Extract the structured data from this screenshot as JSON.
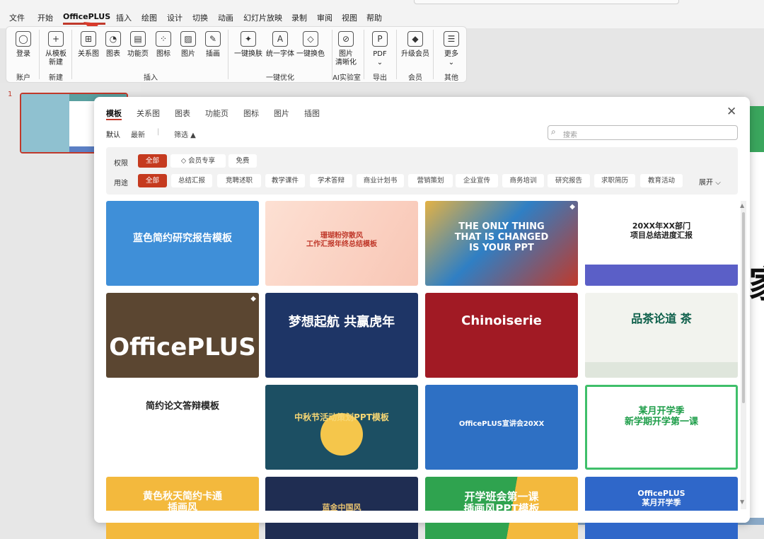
{
  "menu": {
    "items": [
      "文件",
      "开始",
      "OfficePLUS",
      "插入",
      "绘图",
      "设计",
      "切换",
      "动画",
      "幻灯片放映",
      "录制",
      "审阅",
      "视图",
      "帮助"
    ],
    "active_index": 2
  },
  "ribbon": {
    "buttons": [
      {
        "label": "登录",
        "icon": "user-icon"
      },
      {
        "label": "从模板\n新建",
        "icon": "new-from-template-icon"
      },
      {
        "label": "关系图",
        "icon": "relationship-diagram-icon"
      },
      {
        "label": "图表",
        "icon": "chart-icon"
      },
      {
        "label": "功能页",
        "icon": "function-page-icon"
      },
      {
        "label": "图标",
        "icon": "icons-icon"
      },
      {
        "label": "图片",
        "icon": "picture-icon"
      },
      {
        "label": "插画",
        "icon": "illustration-icon"
      },
      {
        "label": "一键换肤",
        "icon": "magic-wand-icon"
      },
      {
        "label": "统一字体",
        "icon": "font-icon"
      },
      {
        "label": "一键换色",
        "icon": "paint-bucket-icon"
      },
      {
        "label": "图片\n清晰化",
        "icon": "image-sharpen-icon"
      },
      {
        "label": "PDF\n⌄",
        "icon": "pdf-icon"
      },
      {
        "label": "升级会员",
        "icon": "diamond-icon"
      },
      {
        "label": "更多\n⌄",
        "icon": "more-icon"
      }
    ],
    "groups": [
      "账户",
      "新建",
      "插入",
      "一键优化",
      "AI实验室",
      "导出",
      "会员",
      "其他"
    ]
  },
  "slides": {
    "current_number": "1"
  },
  "panel": {
    "tabs": [
      "模板",
      "关系图",
      "图表",
      "功能页",
      "图标",
      "图片",
      "插图"
    ],
    "active_tab": 0,
    "sort": [
      "默认",
      "最新"
    ],
    "filter_toggle": "筛选 ▲",
    "search_placeholder": "搜索",
    "permission": {
      "label": "权限",
      "options": [
        "全部",
        "会员专享",
        "免费"
      ],
      "active": 0
    },
    "usage": {
      "label": "用途",
      "options": [
        "全部",
        "总结汇报",
        "竞聘述职",
        "教学课件",
        "学术答辩",
        "商业计划书",
        "营销策划",
        "企业宣传",
        "商务培训",
        "研究报告",
        "求职简历",
        "教育活动"
      ],
      "active": 0
    },
    "expand_label": "展开",
    "close_icon": "close-icon",
    "templates": [
      {
        "title": "蓝色简约研究报告模板",
        "vip": false,
        "color": "#3f8fd8"
      },
      {
        "title": "珊瑚粉弥散风\n工作汇报年终总结模板",
        "vip": false,
        "color": "#fbd5c8"
      },
      {
        "title": "THE ONLY THING\nTHAT IS CHANGED\nIS YOUR PPT",
        "vip": true,
        "color": "#3b86c9"
      },
      {
        "title": "20XX年XX部门\n项目总结进度汇报",
        "vip": true,
        "color": "#ffffff"
      },
      {
        "title": "OfficePLUS",
        "vip": true,
        "color": "#5b4631"
      },
      {
        "title": "梦想起航 共赢虎年",
        "vip": false,
        "color": "#1e3566"
      },
      {
        "title": "Chinoiserie",
        "vip": false,
        "color": "#a11a24"
      },
      {
        "title": "品茶论道 茶",
        "vip": false,
        "color": "#f2f3ee"
      },
      {
        "title": "简约论文答辩模板",
        "vip": false,
        "color": "#ffffff"
      },
      {
        "title": "中秋节活动策划PPT模板",
        "vip": false,
        "color": "#1c4f63"
      },
      {
        "title": "OfficePLUS宣讲会20XX",
        "vip": false,
        "color": "#2e70c4"
      },
      {
        "title": "某月开学季\n新学期开学第一课",
        "vip": false,
        "color": "#ffffff"
      },
      {
        "title": "黄色秋天简约卡通\n插画风",
        "vip": false,
        "color": "#f3b93d"
      },
      {
        "title": "蓝金中国风",
        "vip": false,
        "color": "#1f2d52"
      },
      {
        "title": "开学班会第一课\n插画风PPT模板",
        "vip": false,
        "color": "#2fa34f"
      },
      {
        "title": "OfficePLUS\n某月开学季",
        "vip": false,
        "color": "#2f67c9"
      }
    ]
  }
}
